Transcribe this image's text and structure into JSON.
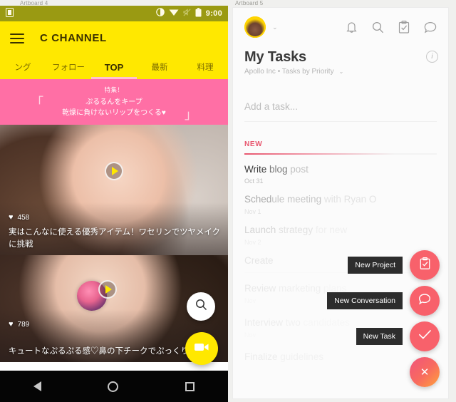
{
  "artboards": {
    "left": "Artboard 4",
    "right": "Artboard 5"
  },
  "left_phone": {
    "status_bar": {
      "time": "9:00",
      "icons": [
        "brightness-icon",
        "wifi-icon",
        "mute-icon",
        "battery-icon"
      ]
    },
    "app_bar": {
      "menu_icon": "hamburger-icon",
      "brand": "C CHANNEL"
    },
    "tabs": [
      {
        "label": "ング",
        "active": false
      },
      {
        "label": "フォロー",
        "active": false
      },
      {
        "label": "TOP",
        "active": true
      },
      {
        "label": "最新",
        "active": false
      },
      {
        "label": "料理",
        "active": false
      }
    ],
    "promo": {
      "kicker": "特集！",
      "quote_open": "「",
      "quote_close": "」",
      "line1": "ぷるるんをキープ",
      "line2": "乾燥に負けないリップをつくる♥"
    },
    "cards": [
      {
        "likes": "458",
        "heart": "♥",
        "title": "実はこんなに使える優秀アイテム！ワセリンでツヤメイクに挑戦",
        "play_icon": "play-icon"
      },
      {
        "likes": "789",
        "heart": "♥",
        "title": "キュートなぷるぷる感♡鼻の下チークでぷっくりビルに♪",
        "play_icon": "play-icon"
      }
    ],
    "fabs": [
      {
        "name": "search-fab",
        "icon": "search-icon"
      },
      {
        "name": "video-fab",
        "icon": "video-camera-icon"
      }
    ],
    "nav_bar": [
      "back-icon",
      "home-icon",
      "recents-icon"
    ],
    "colors": {
      "accent": "#ffe800",
      "promo": "#ff6fa5",
      "status": "#9a9a12"
    }
  },
  "right_phone": {
    "top_bar": {
      "avatar": "user-avatar",
      "avatar_chevron": "⌄",
      "icons": [
        "bell-icon",
        "search-icon",
        "clipboard-check-icon",
        "chat-icon"
      ]
    },
    "header": {
      "title": "My Tasks",
      "subtitle": "Apollo Inc • Tasks by Priority",
      "subtitle_chevron": "⌄",
      "info_icon": "info-icon",
      "info_glyph": "i"
    },
    "add_task_placeholder": "Add a task...",
    "section": {
      "label": "NEW"
    },
    "tasks": [
      {
        "name_strong": "Write",
        "name_mid": " blog",
        "name_dim": " post",
        "date": "Oct 31",
        "fade": "f0"
      },
      {
        "name_strong": "Sched",
        "name_mid": "ule meeting",
        "name_dim": " with Ryan O",
        "date": "Nov 1",
        "fade": "f1"
      },
      {
        "name_strong": "Launch",
        "name_mid": " strategy",
        "name_dim": " for new",
        "date": "Nov 2",
        "fade": "f2"
      },
      {
        "name_strong": "Create",
        "name_mid": "",
        "name_dim": "",
        "date": "",
        "fade": "f3"
      },
      {
        "name_strong": "Review",
        "name_mid": " marketing",
        "name_dim": " plans",
        "date": "Nov",
        "fade": "f4"
      },
      {
        "name_strong": "Interview",
        "name_mid": " two",
        "name_dim": " candidates",
        "date": "Nov",
        "fade": "f5"
      },
      {
        "name_strong": "Finalize",
        "name_mid": " guidelines",
        "name_dim": "",
        "date": "",
        "fade": "f5"
      }
    ],
    "speed_dial": [
      {
        "label": "New Project",
        "icon": "clipboard-check-icon"
      },
      {
        "label": "New Conversation",
        "icon": "chat-bubble-icon"
      },
      {
        "label": "New Task",
        "icon": "check-icon"
      },
      {
        "label": "",
        "icon": "close-icon",
        "glyph": "✕"
      }
    ],
    "colors": {
      "accent": "#f8616b",
      "section": "#e8576f"
    }
  }
}
